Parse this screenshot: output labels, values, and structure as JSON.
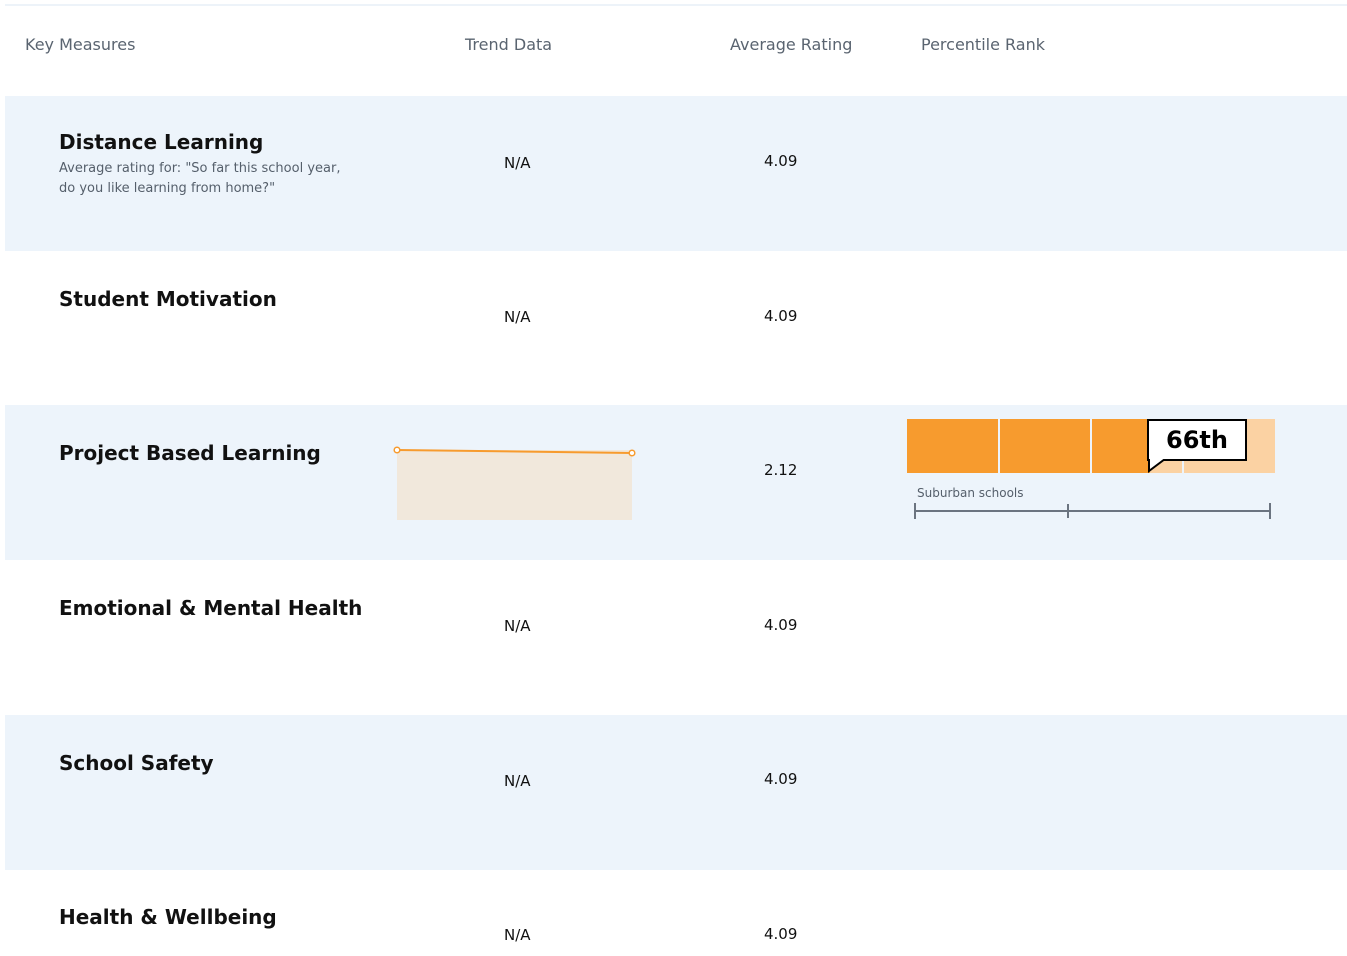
{
  "header": {
    "col_measures": "Key Measures",
    "col_trend": "Trend Data",
    "col_rating": "Average Rating",
    "col_percentile": "Percentile Rank"
  },
  "rows": [
    {
      "title": "Distance Learning",
      "description": "Average rating for: \"So far this school year, do you like learning from home?\"",
      "trend": "N/A",
      "rating": "4.09"
    },
    {
      "title": "Student Motivation",
      "trend": "N/A",
      "rating": "4.09"
    },
    {
      "title": "Project Based Learning",
      "rating": "2.12",
      "trend_values": [
        0.57,
        0.53
      ],
      "percentile": {
        "label": "66th",
        "value": 66,
        "group_label": "Suburban schools"
      }
    },
    {
      "title": "Emotional & Mental Health",
      "trend": "N/A",
      "rating": "4.09"
    },
    {
      "title": "School Safety",
      "trend": "N/A",
      "rating": "4.09"
    },
    {
      "title": "Health & Wellbeing",
      "trend": "N/A",
      "rating": "4.09"
    }
  ],
  "colors": {
    "accent_orange": "#f79b2e",
    "orange_light": "#fbd2a3",
    "trend_fill": "#f1e8dc",
    "row_shade": "#edf4fb",
    "scale_gray": "#6b7480"
  }
}
